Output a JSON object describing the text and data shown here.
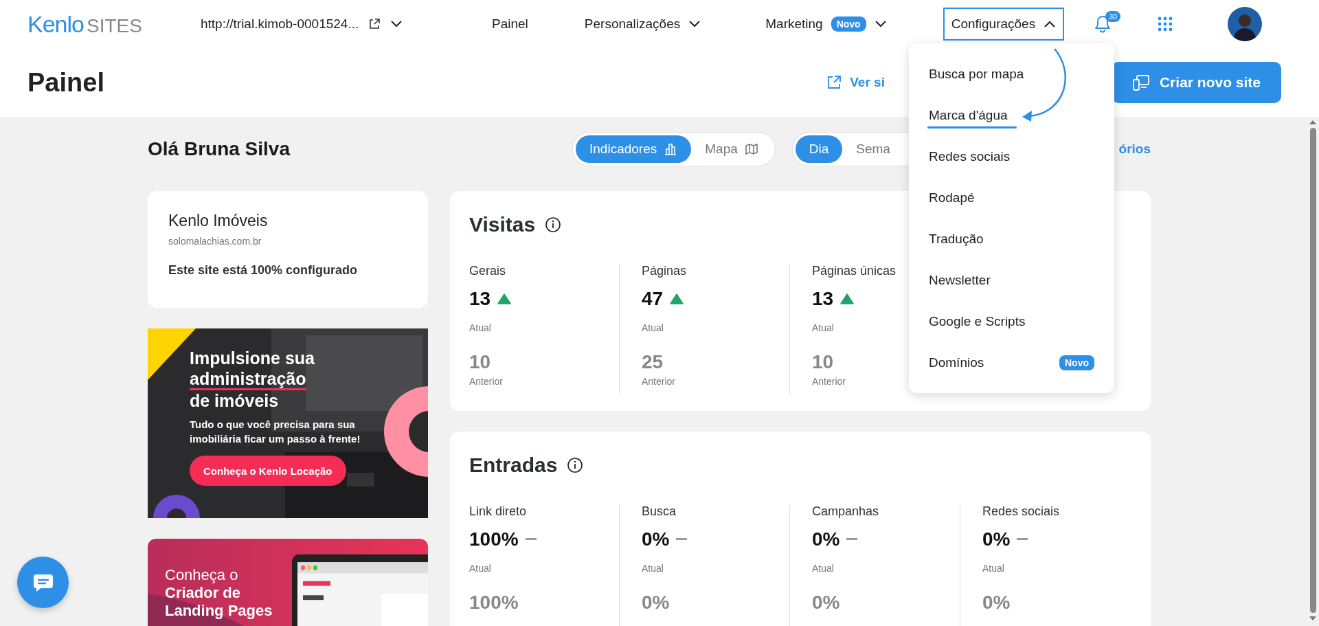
{
  "header": {
    "logo": {
      "brand": "Kenlo",
      "product": "SITES"
    },
    "site_url": "http://trial.kimob-0001524...",
    "nav": [
      {
        "label": "Painel",
        "kind": "link"
      },
      {
        "label": "Personalizações",
        "kind": "menu",
        "expanded": false,
        "focused": false
      },
      {
        "label": "Marketing",
        "kind": "menu",
        "expanded": false,
        "focused": false,
        "badge": "Novo"
      },
      {
        "label": "Configurações",
        "kind": "menu",
        "expanded": true,
        "focused": true
      }
    ],
    "notifications": "30"
  },
  "page": {
    "title": "Painel",
    "view_site_link": "Ver si",
    "create_button": "Criar novo site"
  },
  "greeting": "Olá Bruna Silva",
  "view_toggle": [
    {
      "label": "Indicadores",
      "selected": true
    },
    {
      "label": "Mapa",
      "selected": false
    }
  ],
  "period_toggle": [
    {
      "label": "Dia",
      "selected": true
    },
    {
      "label": "Sema",
      "selected": false
    }
  ],
  "reports_link": "órios",
  "site_card": {
    "name": "Kenlo Imóveis",
    "domain": "solomalachias.com.br",
    "status": "Este site está 100% configurado"
  },
  "promo": {
    "title_lines": [
      {
        "text": "Impulsione sua",
        "underlined": false
      },
      {
        "text": "administração",
        "underlined": true
      },
      {
        "text": "de imóveis",
        "underlined": false
      }
    ],
    "subtitle": "Tudo o que você precisa para sua imobiliária ficar um passo à frente!",
    "button": "Conheça o Kenlo Locação"
  },
  "landing_promo": {
    "text": "Conheça o **Criador de Landing Pages**"
  },
  "sections": [
    {
      "title": "Visitas",
      "metrics": [
        {
          "label": "Gerais",
          "current": "13",
          "rising": true,
          "current_caption": "Atual",
          "previous": "10",
          "previous_caption": "Anterior"
        },
        {
          "label": "Páginas",
          "current": "47",
          "rising": true,
          "current_caption": "Atual",
          "previous": "25",
          "previous_caption": "Anterior"
        },
        {
          "label": "Páginas únicas",
          "current": "13",
          "rising": true,
          "current_caption": "Atual",
          "previous": "10",
          "previous_caption": "Anterior"
        }
      ]
    },
    {
      "title": "Entradas",
      "metrics": [
        {
          "label": "Link direto",
          "current": "100%",
          "rising": false,
          "current_caption": "Atual",
          "previous": "100%"
        },
        {
          "label": "Busca",
          "current": "0%",
          "rising": false,
          "current_caption": "Atual",
          "previous": "0%"
        },
        {
          "label": "Campanhas",
          "current": "0%",
          "rising": false,
          "current_caption": "Atual",
          "previous": "0%"
        },
        {
          "label": "Redes sociais",
          "current": "0%",
          "rising": false,
          "current_caption": "Atual",
          "previous": "0%"
        }
      ]
    }
  ],
  "dropdown": {
    "items": [
      {
        "label": "Busca por mapa",
        "marked": false
      },
      {
        "label": "Marca d'água",
        "marked": true
      },
      {
        "label": "Redes sociais",
        "marked": false
      },
      {
        "label": "Rodapé",
        "marked": false
      },
      {
        "label": "Tradução",
        "marked": false
      },
      {
        "label": "Newsletter",
        "marked": false
      },
      {
        "label": "Google e Scripts",
        "marked": false
      },
      {
        "label": "Domínios",
        "marked": false,
        "badge": "Novo"
      }
    ]
  }
}
